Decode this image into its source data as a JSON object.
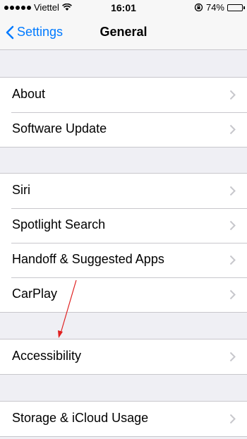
{
  "statusbar": {
    "carrier": "Viettel",
    "time": "16:01",
    "battery": "74%",
    "battery_level": 0.74
  },
  "navbar": {
    "back_label": "Settings",
    "title": "General"
  },
  "groups": [
    [
      "About",
      "Software Update"
    ],
    [
      "Siri",
      "Spotlight Search",
      "Handoff & Suggested Apps",
      "CarPlay"
    ],
    [
      "Accessibility"
    ],
    [
      "Storage & iCloud Usage"
    ]
  ]
}
